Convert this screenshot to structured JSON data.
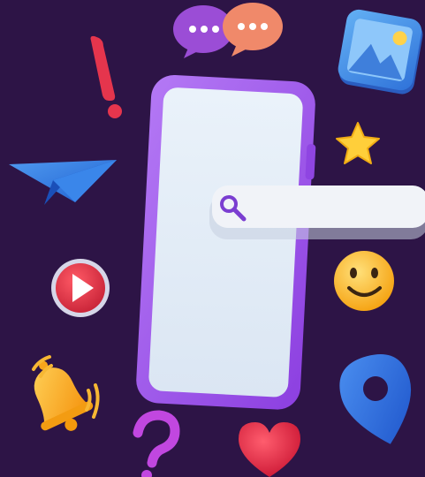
{
  "scene": {
    "background_color": "#2d1446",
    "phone": {
      "frame_color": "#a35cf0",
      "screen_color": "#e4eef8"
    },
    "search_bar": {
      "value": "",
      "placeholder": "",
      "icon": "search-icon",
      "accent_color": "#7b3ed1"
    },
    "floating_icons": [
      {
        "name": "chat-bubble-purple-icon",
        "color": "#9b4dd6"
      },
      {
        "name": "chat-bubble-orange-icon",
        "color": "#f0896a"
      },
      {
        "name": "exclamation-icon",
        "color": "#e5354d"
      },
      {
        "name": "image-gallery-icon",
        "color": "#3d8de8"
      },
      {
        "name": "star-icon",
        "color": "#ffcf3a"
      },
      {
        "name": "paper-plane-icon",
        "color": "#2f7fe2"
      },
      {
        "name": "smiley-icon",
        "color": "#ffb41d"
      },
      {
        "name": "play-button-icon",
        "color": "#e63a4a"
      },
      {
        "name": "bell-icon",
        "color": "#ffb02e"
      },
      {
        "name": "question-mark-icon",
        "color": "#c147e0"
      },
      {
        "name": "heart-icon",
        "color": "#e0203c"
      },
      {
        "name": "location-pin-icon",
        "color": "#2e6fdf"
      }
    ]
  }
}
